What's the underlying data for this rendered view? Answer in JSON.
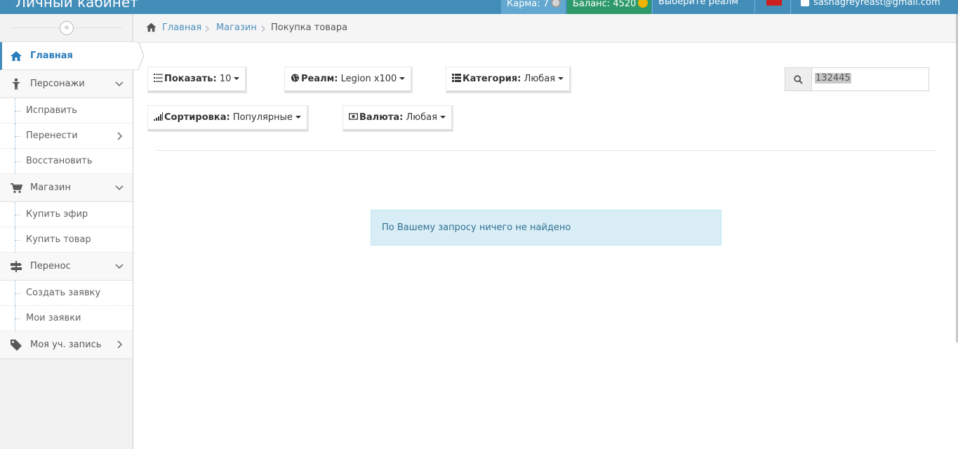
{
  "header": {
    "brand": "Личный кабинет",
    "karma_label": "Карма: 7",
    "balance_label": "Баланс: 4520",
    "realm_label": "Выберите реалм",
    "user_email": "sashagreyreast@gmail.com"
  },
  "sidebar": {
    "collapse_icon": "«",
    "items": [
      {
        "label": "Главная",
        "icon": "home-icon"
      },
      {
        "label": "Персонажи",
        "icon": "person-icon"
      },
      {
        "label": "Исправить"
      },
      {
        "label": "Перенести"
      },
      {
        "label": "Восстановить"
      },
      {
        "label": "Магазин",
        "icon": "cart-icon"
      },
      {
        "label": "Купить эфир"
      },
      {
        "label": "Купить товар"
      },
      {
        "label": "Перенос",
        "icon": "signpost-icon"
      },
      {
        "label": "Создать заявку"
      },
      {
        "label": "Мои заявки"
      },
      {
        "label": "Моя уч. запись",
        "icon": "tag-icon"
      }
    ]
  },
  "breadcrumbs": {
    "home": "Главная",
    "shop": "Магазин",
    "current": "Покупка товара"
  },
  "filters": {
    "show_label": "Показать:",
    "show_value": "10",
    "realm_label": "Реалм:",
    "realm_value": "Legion x100",
    "category_label": "Категория:",
    "category_value": "Любая",
    "sort_label": "Сортировка:",
    "sort_value": "Популярные",
    "currency_label": "Валюта:",
    "currency_value": "Любая"
  },
  "search": {
    "value": "132445"
  },
  "result": {
    "message": "По Вашему запросу ничего не найдено"
  },
  "colors": {
    "header_bg": "#438eb9",
    "balance_bg": "#2e9a6b",
    "link": "#4c8fbd",
    "alert_bg": "#d9edf7"
  }
}
